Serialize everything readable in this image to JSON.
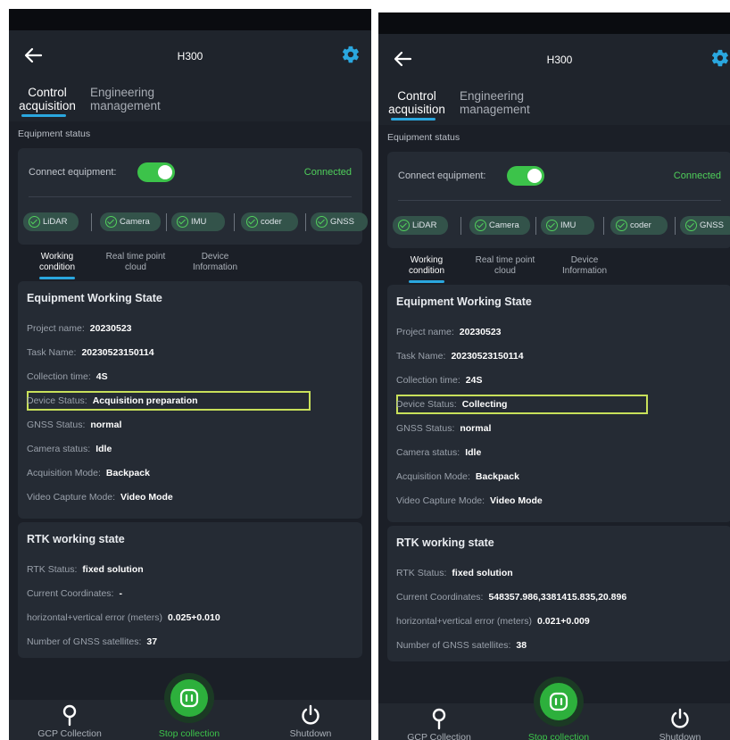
{
  "screens": [
    {
      "app_title": "H300",
      "tabs": [
        "Control acquisition",
        "Engineering management"
      ],
      "equipment_status_label": "Equipment status",
      "connect_label": "Connect equipment:",
      "connect_status": "Connected",
      "connect_on": true,
      "sensors": [
        "LiDAR",
        "Camera",
        "IMU",
        "coder",
        "GNSS"
      ],
      "subtabs": [
        "Working condition",
        "Real time point cloud",
        "Device Information"
      ],
      "working_state": {
        "title": "Equipment Working State",
        "rows": [
          {
            "label": "Project name:",
            "value": "20230523"
          },
          {
            "label": "Task Name:",
            "value": "20230523150114"
          },
          {
            "label": "Collection time:",
            "value": "4S"
          },
          {
            "label": "Device Status:",
            "value": "Acquisition preparation"
          },
          {
            "label": "GNSS Status:",
            "value": "normal"
          },
          {
            "label": "Camera status:",
            "value": "Idle"
          },
          {
            "label": "Acquisition Mode:",
            "value": "Backpack"
          },
          {
            "label": "Video Capture Mode:",
            "value": "Video Mode"
          }
        ]
      },
      "rtk_state": {
        "title": "RTK working state",
        "rows": [
          {
            "label": "RTK Status:",
            "value": "fixed solution"
          },
          {
            "label": "Current Coordinates:",
            "value": "-"
          },
          {
            "label": "horizontal+vertical error (meters)",
            "value": "0.025+0.010"
          },
          {
            "label": "Number of GNSS satellites:",
            "value": "37"
          }
        ]
      },
      "bottom_nav": [
        "GCP Collection",
        "Stop collection",
        "Shutdown"
      ]
    },
    {
      "app_title": "H300",
      "tabs": [
        "Control acquisition",
        "Engineering management"
      ],
      "equipment_status_label": "Equipment status",
      "connect_label": "Connect equipment:",
      "connect_status": "Connected",
      "connect_on": true,
      "sensors": [
        "LiDAR",
        "Camera",
        "IMU",
        "coder",
        "GNSS"
      ],
      "subtabs": [
        "Working condition",
        "Real time point cloud",
        "Device Information"
      ],
      "working_state": {
        "title": "Equipment Working State",
        "rows": [
          {
            "label": "Project name:",
            "value": "20230523"
          },
          {
            "label": "Task Name:",
            "value": "20230523150114"
          },
          {
            "label": "Collection time:",
            "value": "24S"
          },
          {
            "label": "Device Status:",
            "value": "Collecting"
          },
          {
            "label": "GNSS Status:",
            "value": "normal"
          },
          {
            "label": "Camera status:",
            "value": "Idle"
          },
          {
            "label": "Acquisition Mode:",
            "value": "Backpack"
          },
          {
            "label": "Video Capture Mode:",
            "value": "Video Mode"
          }
        ]
      },
      "rtk_state": {
        "title": "RTK working state",
        "rows": [
          {
            "label": "RTK Status:",
            "value": "fixed solution"
          },
          {
            "label": "Current Coordinates:",
            "value": "548357.986,3381415.835,20.896"
          },
          {
            "label": "horizontal+vertical error (meters)",
            "value": "0.021+0.009"
          },
          {
            "label": "Number of GNSS satellites:",
            "value": "38"
          }
        ]
      },
      "bottom_nav": [
        "GCP Collection",
        "Stop collection",
        "Shutdown"
      ]
    }
  ],
  "colors": {
    "background": "#1b1f27",
    "accent_blue": "#2aa7df",
    "accent_green": "#3cc34a",
    "highlight_box": "#c8e05a"
  },
  "icons": [
    "back-arrow-icon",
    "gear-icon",
    "check-circle-icon",
    "location-pin-icon",
    "stop-icon",
    "power-icon"
  ]
}
